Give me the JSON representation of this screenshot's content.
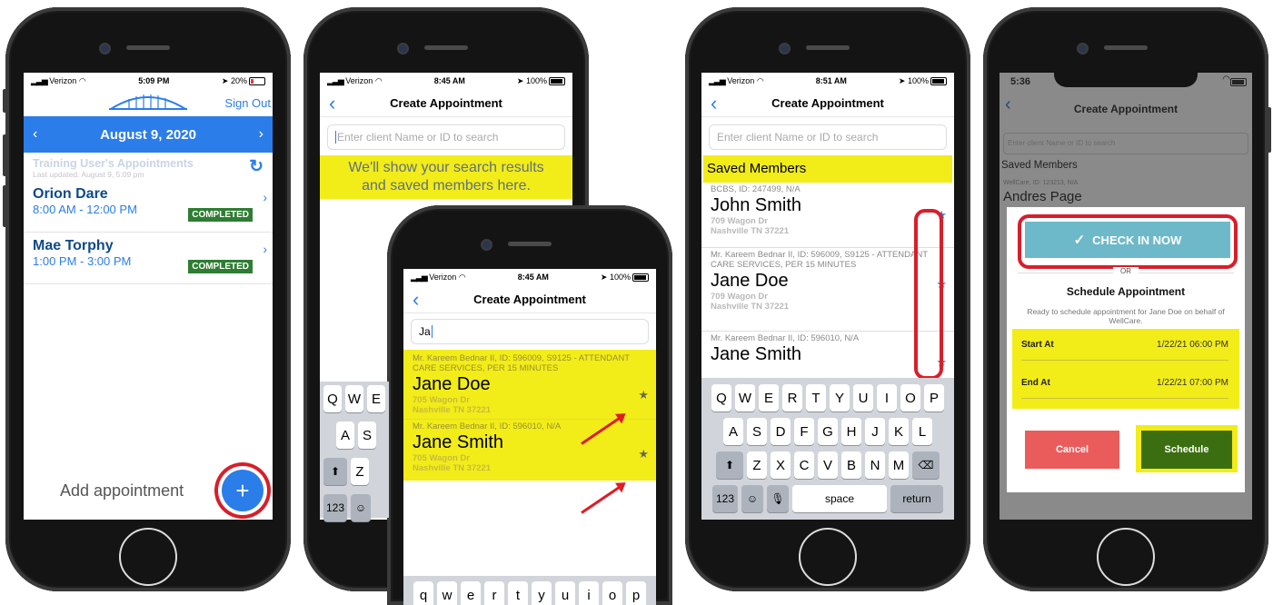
{
  "p1": {
    "carrier": "Verizon",
    "time": "5:09 PM",
    "battery": "20%",
    "sign_out": "Sign Out",
    "date": "August 9, 2020",
    "section_title": "Training User's Appointments",
    "last_updated": "Last updated: August 9, 5:09 pm",
    "appointments": [
      {
        "name": "Orion Dare",
        "time": "8:00 AM - 12:00 PM",
        "status": "COMPLETED"
      },
      {
        "name": "Mae Torphy",
        "time": "1:00 PM - 3:00 PM",
        "status": "COMPLETED"
      }
    ],
    "add_label": "Add appointment"
  },
  "p2": {
    "carrier": "Verizon",
    "time": "8:45 AM",
    "battery": "100%",
    "title": "Create Appointment",
    "search_placeholder": "Enter client Name or ID to search",
    "empty_msg": "We'll show your search results and saved members here."
  },
  "p3": {
    "carrier": "Verizon",
    "time": "8:45 AM",
    "battery": "100%",
    "title": "Create Appointment",
    "search_value": "Ja",
    "results": [
      {
        "meta": "Mr. Kareem Bednar II, ID: 596009, S9125 - ATTENDANT CARE SERVICES, PER 15 MINUTES",
        "name": "Jane Doe",
        "addr1": "705 Wagon Dr",
        "addr2": "Nashville TN 37221"
      },
      {
        "meta": "Mr. Kareem Bednar II, ID: 596010, N/A",
        "name": "Jane Smith",
        "addr1": "705 Wagon Dr",
        "addr2": "Nashville TN 37221"
      }
    ],
    "keys_row1": [
      "q",
      "w",
      "e",
      "r",
      "t",
      "y",
      "u",
      "i",
      "o",
      "p"
    ]
  },
  "p4": {
    "carrier": "Verizon",
    "time": "8:51 AM",
    "battery": "100%",
    "title": "Create Appointment",
    "search_placeholder": "Enter client Name or ID to search",
    "saved_header": "Saved Members",
    "members": [
      {
        "meta": "BCBS, ID: 247499, N/A",
        "name": "John Smith",
        "addr1": "709 Wagon Dr",
        "addr2": "Nashville TN 37221"
      },
      {
        "meta": "Mr. Kareem Bednar II, ID: 596009, S9125 - ATTENDANT CARE SERVICES, PER 15 MINUTES",
        "name": "Jane Doe",
        "addr1": "709 Wagon Dr",
        "addr2": "Nashville TN 37221"
      },
      {
        "meta": "Mr. Kareem Bednar II, ID: 596010, N/A",
        "name": "Jane Smith"
      }
    ],
    "keys_row1": [
      "Q",
      "W",
      "E",
      "R",
      "T",
      "Y",
      "U",
      "I",
      "O",
      "P"
    ],
    "keys_row2": [
      "A",
      "S",
      "D",
      "F",
      "G",
      "H",
      "J",
      "K",
      "L"
    ],
    "keys_row3": [
      "Z",
      "X",
      "C",
      "V",
      "B",
      "N",
      "M"
    ],
    "key_123": "123",
    "key_space": "space",
    "key_return": "return"
  },
  "p5": {
    "time": "5:36",
    "title": "Create Appointment",
    "search_placeholder": "Enter client Name or ID to search",
    "saved_header": "Saved Members",
    "bg_meta": "WellCare, ID: 123213, N/A",
    "bg_name": "Andres Page",
    "checkin": "CHECK IN NOW",
    "or": "OR",
    "schedule_title": "Schedule Appointment",
    "ready_msg": "Ready to schedule appointment for Jane Doe on behalf of WellCare.",
    "start_label": "Start At",
    "start_value": "1/22/21 06:00 PM",
    "end_label": "End At",
    "end_value": "1/22/21 07:00 PM",
    "cancel": "Cancel",
    "schedule": "Schedule"
  },
  "colors": {
    "blue": "#2b7de9",
    "green": "#2e7d32",
    "highlight": "#f2ec19",
    "red": "#d81e2a",
    "teal": "#6db9c9",
    "cancel": "#ea5c5c",
    "schedule": "#3b6e10"
  }
}
